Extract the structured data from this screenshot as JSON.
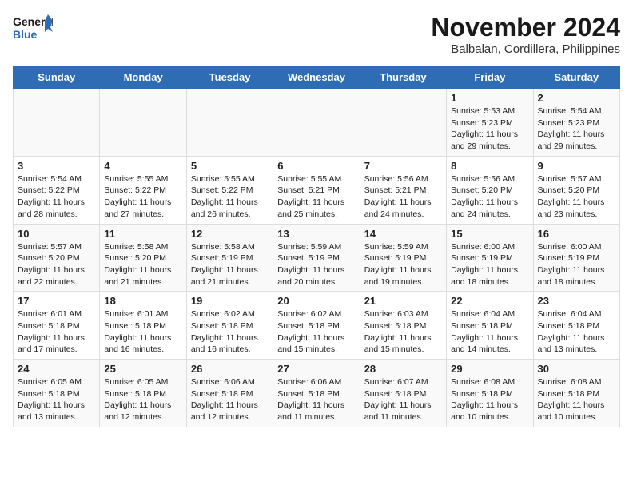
{
  "logo": {
    "line1": "General",
    "line2": "Blue"
  },
  "title": "November 2024",
  "subtitle": "Balbalan, Cordillera, Philippines",
  "weekdays": [
    "Sunday",
    "Monday",
    "Tuesday",
    "Wednesday",
    "Thursday",
    "Friday",
    "Saturday"
  ],
  "weeks": [
    [
      {
        "day": "",
        "info": ""
      },
      {
        "day": "",
        "info": ""
      },
      {
        "day": "",
        "info": ""
      },
      {
        "day": "",
        "info": ""
      },
      {
        "day": "",
        "info": ""
      },
      {
        "day": "1",
        "info": "Sunrise: 5:53 AM\nSunset: 5:23 PM\nDaylight: 11 hours\nand 29 minutes."
      },
      {
        "day": "2",
        "info": "Sunrise: 5:54 AM\nSunset: 5:23 PM\nDaylight: 11 hours\nand 29 minutes."
      }
    ],
    [
      {
        "day": "3",
        "info": "Sunrise: 5:54 AM\nSunset: 5:22 PM\nDaylight: 11 hours\nand 28 minutes."
      },
      {
        "day": "4",
        "info": "Sunrise: 5:55 AM\nSunset: 5:22 PM\nDaylight: 11 hours\nand 27 minutes."
      },
      {
        "day": "5",
        "info": "Sunrise: 5:55 AM\nSunset: 5:22 PM\nDaylight: 11 hours\nand 26 minutes."
      },
      {
        "day": "6",
        "info": "Sunrise: 5:55 AM\nSunset: 5:21 PM\nDaylight: 11 hours\nand 25 minutes."
      },
      {
        "day": "7",
        "info": "Sunrise: 5:56 AM\nSunset: 5:21 PM\nDaylight: 11 hours\nand 24 minutes."
      },
      {
        "day": "8",
        "info": "Sunrise: 5:56 AM\nSunset: 5:20 PM\nDaylight: 11 hours\nand 24 minutes."
      },
      {
        "day": "9",
        "info": "Sunrise: 5:57 AM\nSunset: 5:20 PM\nDaylight: 11 hours\nand 23 minutes."
      }
    ],
    [
      {
        "day": "10",
        "info": "Sunrise: 5:57 AM\nSunset: 5:20 PM\nDaylight: 11 hours\nand 22 minutes."
      },
      {
        "day": "11",
        "info": "Sunrise: 5:58 AM\nSunset: 5:20 PM\nDaylight: 11 hours\nand 21 minutes."
      },
      {
        "day": "12",
        "info": "Sunrise: 5:58 AM\nSunset: 5:19 PM\nDaylight: 11 hours\nand 21 minutes."
      },
      {
        "day": "13",
        "info": "Sunrise: 5:59 AM\nSunset: 5:19 PM\nDaylight: 11 hours\nand 20 minutes."
      },
      {
        "day": "14",
        "info": "Sunrise: 5:59 AM\nSunset: 5:19 PM\nDaylight: 11 hours\nand 19 minutes."
      },
      {
        "day": "15",
        "info": "Sunrise: 6:00 AM\nSunset: 5:19 PM\nDaylight: 11 hours\nand 18 minutes."
      },
      {
        "day": "16",
        "info": "Sunrise: 6:00 AM\nSunset: 5:19 PM\nDaylight: 11 hours\nand 18 minutes."
      }
    ],
    [
      {
        "day": "17",
        "info": "Sunrise: 6:01 AM\nSunset: 5:18 PM\nDaylight: 11 hours\nand 17 minutes."
      },
      {
        "day": "18",
        "info": "Sunrise: 6:01 AM\nSunset: 5:18 PM\nDaylight: 11 hours\nand 16 minutes."
      },
      {
        "day": "19",
        "info": "Sunrise: 6:02 AM\nSunset: 5:18 PM\nDaylight: 11 hours\nand 16 minutes."
      },
      {
        "day": "20",
        "info": "Sunrise: 6:02 AM\nSunset: 5:18 PM\nDaylight: 11 hours\nand 15 minutes."
      },
      {
        "day": "21",
        "info": "Sunrise: 6:03 AM\nSunset: 5:18 PM\nDaylight: 11 hours\nand 15 minutes."
      },
      {
        "day": "22",
        "info": "Sunrise: 6:04 AM\nSunset: 5:18 PM\nDaylight: 11 hours\nand 14 minutes."
      },
      {
        "day": "23",
        "info": "Sunrise: 6:04 AM\nSunset: 5:18 PM\nDaylight: 11 hours\nand 13 minutes."
      }
    ],
    [
      {
        "day": "24",
        "info": "Sunrise: 6:05 AM\nSunset: 5:18 PM\nDaylight: 11 hours\nand 13 minutes."
      },
      {
        "day": "25",
        "info": "Sunrise: 6:05 AM\nSunset: 5:18 PM\nDaylight: 11 hours\nand 12 minutes."
      },
      {
        "day": "26",
        "info": "Sunrise: 6:06 AM\nSunset: 5:18 PM\nDaylight: 11 hours\nand 12 minutes."
      },
      {
        "day": "27",
        "info": "Sunrise: 6:06 AM\nSunset: 5:18 PM\nDaylight: 11 hours\nand 11 minutes."
      },
      {
        "day": "28",
        "info": "Sunrise: 6:07 AM\nSunset: 5:18 PM\nDaylight: 11 hours\nand 11 minutes."
      },
      {
        "day": "29",
        "info": "Sunrise: 6:08 AM\nSunset: 5:18 PM\nDaylight: 11 hours\nand 10 minutes."
      },
      {
        "day": "30",
        "info": "Sunrise: 6:08 AM\nSunset: 5:18 PM\nDaylight: 11 hours\nand 10 minutes."
      }
    ]
  ]
}
